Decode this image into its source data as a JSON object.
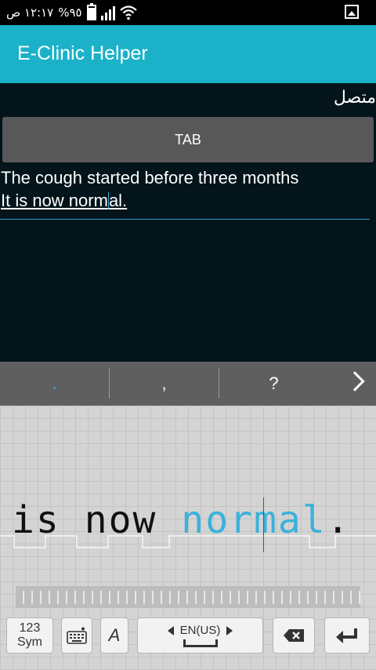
{
  "status_bar": {
    "time": "١٢:١٧ ص",
    "battery": "%٩٥",
    "icons": [
      "battery-icon",
      "signal-icon",
      "wifi-icon",
      "gallery-icon"
    ]
  },
  "app_bar": {
    "title": "E-Clinic Helper"
  },
  "main": {
    "connection_status": "متصل",
    "tab_button": "TAB",
    "text_line1": "The cough started before three months",
    "text_line2_a": "It is now norm",
    "text_line2_b": "al."
  },
  "suggestions": {
    "items": [
      ".",
      ",",
      "?"
    ],
    "more_icon": "chevron-right-icon"
  },
  "handwriting": {
    "text_plain": "is now ",
    "text_highlight": "normal",
    "text_tail": ".",
    "highlight_color": "#3ab2db"
  },
  "keyboard": {
    "sym_line1": "123",
    "sym_line2": "Sym",
    "style_label": "A",
    "language": "EN(US)",
    "icons": [
      "keyboard-settings-icon",
      "backspace-icon",
      "enter-icon"
    ]
  },
  "colors": {
    "app_bar": "#1ab1c9",
    "background": "#03141b",
    "underline": "#2f96c5"
  }
}
